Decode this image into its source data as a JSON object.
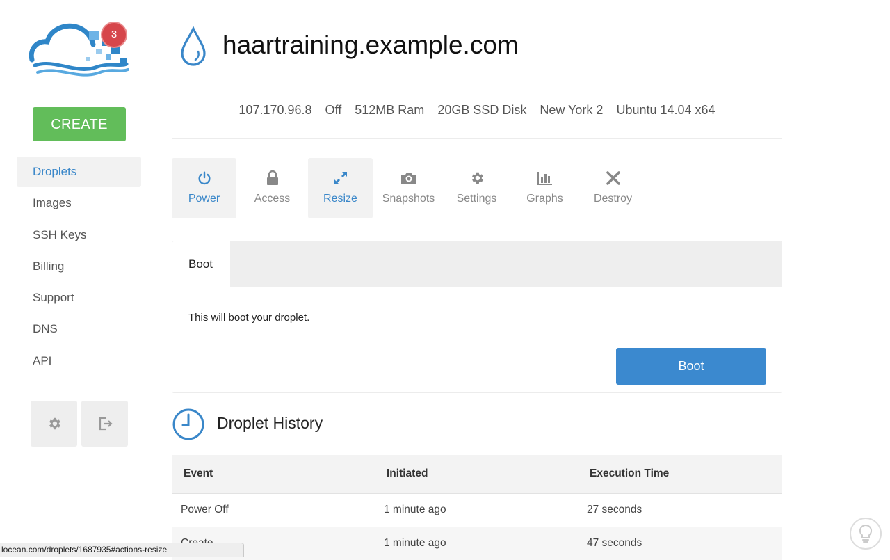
{
  "sidebar": {
    "notification_count": "3",
    "create_label": "CREATE",
    "nav": [
      {
        "label": "Droplets",
        "active": true
      },
      {
        "label": "Images"
      },
      {
        "label": "SSH Keys"
      },
      {
        "label": "Billing"
      },
      {
        "label": "Support"
      },
      {
        "label": "DNS"
      },
      {
        "label": "API"
      }
    ],
    "bottom_icons": [
      "gear-icon",
      "logout-icon"
    ]
  },
  "droplet": {
    "name": "haartraining.example.com",
    "info": [
      "107.170.96.8",
      "Off",
      "512MB Ram",
      "20GB SSD Disk",
      "New York 2",
      "Ubuntu 14.04 x64"
    ]
  },
  "tabs": [
    {
      "label": "Power",
      "icon": "power-icon",
      "selected": true
    },
    {
      "label": "Access",
      "icon": "lock-icon"
    },
    {
      "label": "Resize",
      "icon": "resize-arrows-icon",
      "selected": true
    },
    {
      "label": "Snapshots",
      "icon": "camera-icon"
    },
    {
      "label": "Settings",
      "icon": "gear-icon"
    },
    {
      "label": "Graphs",
      "icon": "bar-chart-icon"
    },
    {
      "label": "Destroy",
      "icon": "x-icon"
    }
  ],
  "power_panel": {
    "tab_label": "Boot",
    "description": "This will boot your droplet.",
    "button_label": "Boot"
  },
  "history": {
    "title": "Droplet History",
    "columns": [
      "Event",
      "Initiated",
      "Execution Time"
    ],
    "rows": [
      [
        "Power Off",
        "1 minute ago",
        "27 seconds"
      ],
      [
        "Create",
        "1 minute ago",
        "47 seconds"
      ]
    ]
  },
  "status_bar": {
    "url": "locean.com/droplets/1687935#actions-resize"
  },
  "colors": {
    "accent_blue": "#3a87c9",
    "create_green": "#62bd5a",
    "badge_red": "#d6464b"
  }
}
